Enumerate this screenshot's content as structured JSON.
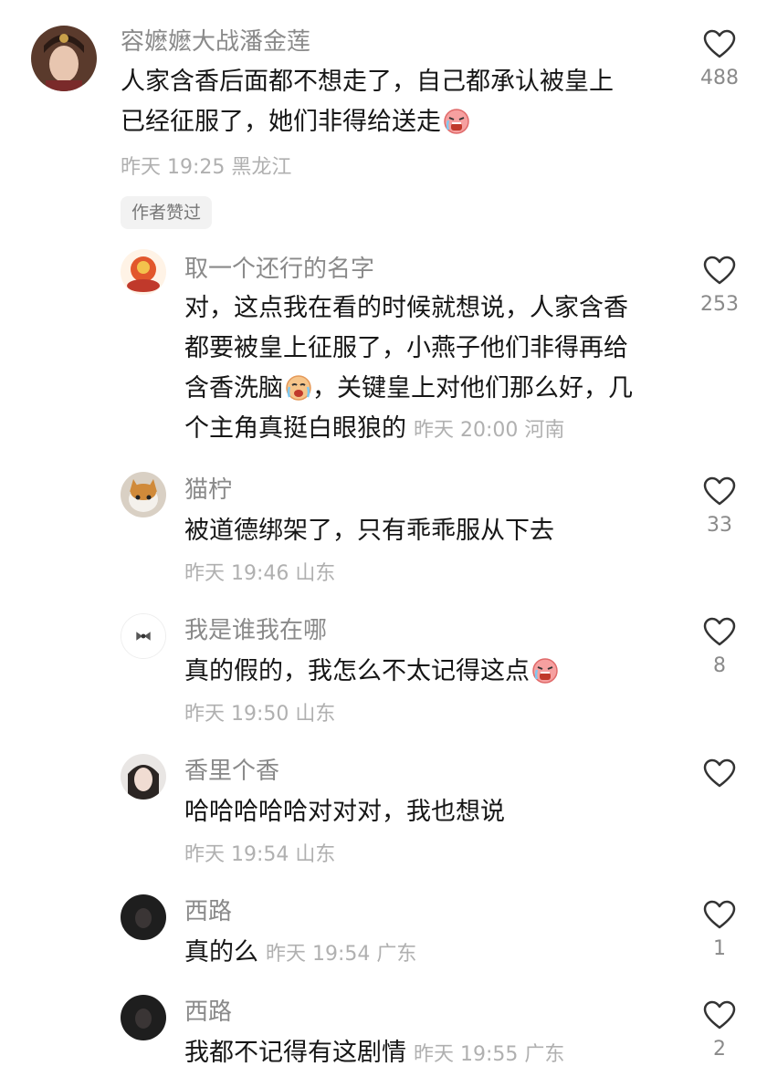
{
  "author_liked_badge": "作者赞过",
  "comments": [
    {
      "user": "容嬷嬷大战潘金莲",
      "line1": "人家含香后面都不想走了，自己都承认被皇上",
      "line2": "已经征服了，她们非得给送走",
      "meta": "昨天 19:25 黑龙江",
      "likes": "488",
      "emoji": "crying-face"
    },
    {
      "user": "取一个还行的名字",
      "line1": "对，这点我在看的时候就想说，人家含香",
      "line2": "都要被皇上征服了，小燕子他们非得再给",
      "line3a": "含香洗脑",
      "line3b": "，关键皇上对他们那么好，几",
      "line4": "个主角真挺白眼狼的",
      "meta": "昨天 20:00 河南",
      "likes": "253",
      "emoji": "crying-face"
    },
    {
      "user": "猫柠",
      "text": "被道德绑架了，只有乖乖服从下去",
      "meta": "昨天 19:46 山东",
      "likes": "33"
    },
    {
      "user": "我是谁我在哪",
      "text": "真的假的，我怎么不太记得这点",
      "meta": "昨天 19:50 山东",
      "likes": "8",
      "emoji": "crying-face"
    },
    {
      "user": "香里个香",
      "text": "哈哈哈哈哈对对对，我也想说",
      "meta": "昨天 19:54 山东",
      "likes": ""
    },
    {
      "user": "西路",
      "text": "真的么",
      "meta": "昨天 19:54 广东",
      "likes": "1"
    },
    {
      "user": "西路",
      "text": "我都不记得有这剧情",
      "meta": "昨天 19:55 广东",
      "likes": "2"
    }
  ]
}
